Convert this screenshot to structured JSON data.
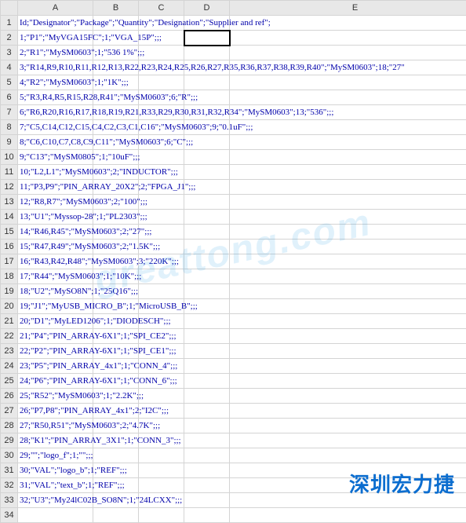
{
  "columns": [
    "A",
    "B",
    "C",
    "D",
    "E"
  ],
  "selected_cell": "D2",
  "watermark": "greattong.com",
  "logo_text": "深圳宏力捷",
  "rows": [
    {
      "n": 1,
      "text": "Id;\"Designator\";\"Package\";\"Quantity\";\"Designation\";\"Supplier and ref\";"
    },
    {
      "n": 2,
      "text": "1;\"P1\";\"MyVGA15FC\";1;\"VGA_15P\";;;"
    },
    {
      "n": 3,
      "text": "2;\"R1\";\"MySM0603\";1;\"536 1%\";;;"
    },
    {
      "n": 4,
      "text": "3;\"R14,R9,R10,R11,R12,R13,R22,R23,R24,R25,R26,R27,R35,R36,R37,R38,R39,R40\";\"MySM0603\";18;\"27\""
    },
    {
      "n": 5,
      "text": "4;\"R2\";\"MySM0603\";1;\"1K\";;;"
    },
    {
      "n": 6,
      "text": "5;\"R3,R4,R5,R15,R28,R41\";\"MySM0603\";6;\"R\";;;"
    },
    {
      "n": 7,
      "text": "6;\"R6,R20,R16,R17,R18,R19,R21,R33,R29,R30,R31,R32,R34\";\"MySM0603\";13;\"536\";;;"
    },
    {
      "n": 8,
      "text": "7;\"C5,C14,C12,C15,C4,C2,C3,C1,C16\";\"MySM0603\";9;\"0.1uF\";;;"
    },
    {
      "n": 9,
      "text": "8;\"C6,C10,C7,C8,C9,C11\";\"MySM0603\";6;\"C\";;;"
    },
    {
      "n": 10,
      "text": "9;\"C13\";\"MySM0805\";1;\"10uF\";;;"
    },
    {
      "n": 11,
      "text": "10;\"L2,L1\";\"MySM0603\";2;\"INDUCTOR\";;;"
    },
    {
      "n": 12,
      "text": "11;\"P3,P9\";\"PIN_ARRAY_20X2\";2;\"FPGA_J1\";;;"
    },
    {
      "n": 13,
      "text": "12;\"R8,R7\";\"MySM0603\";2;\"100\";;;"
    },
    {
      "n": 14,
      "text": "13;\"U1\";\"Myssop-28\";1;\"PL2303\";;;"
    },
    {
      "n": 15,
      "text": "14;\"R46,R45\";\"MySM0603\";2;\"27\";;;"
    },
    {
      "n": 16,
      "text": "15;\"R47,R49\";\"MySM0603\";2;\"1.5K\";;;"
    },
    {
      "n": 17,
      "text": "16;\"R43,R42,R48\";\"MySM0603\";3;\"220K\";;;"
    },
    {
      "n": 18,
      "text": "17;\"R44\";\"MySM0603\";1;\"10K\";;;"
    },
    {
      "n": 19,
      "text": "18;\"U2\";\"MySO8N\";1;\"25Q16\";;;"
    },
    {
      "n": 20,
      "text": "19;\"J1\";\"MyUSB_MICRO_B\";1;\"MicroUSB_B\";;;"
    },
    {
      "n": 21,
      "text": "20;\"D1\";\"MyLED1206\";1;\"DIODESCH\";;;"
    },
    {
      "n": 22,
      "text": "21;\"P4\";\"PIN_ARRAY-6X1\";1;\"SPI_CE2\";;;"
    },
    {
      "n": 23,
      "text": "22;\"P2\";\"PIN_ARRAY-6X1\";1;\"SPI_CE1\";;;"
    },
    {
      "n": 24,
      "text": "23;\"P5\";\"PIN_ARRAY_4x1\";1;\"CONN_4\";;;"
    },
    {
      "n": 25,
      "text": "24;\"P6\";\"PIN_ARRAY-6X1\";1;\"CONN_6\";;;"
    },
    {
      "n": 26,
      "text": "25;\"R52\";\"MySM0603\";1;\"2.2K\";;;"
    },
    {
      "n": 27,
      "text": "26;\"P7,P8\";\"PIN_ARRAY_4x1\";2;\"I2C\";;;"
    },
    {
      "n": 28,
      "text": "27;\"R50,R51\";\"MySM0603\";2;\"4.7K\";;;"
    },
    {
      "n": 29,
      "text": "28;\"K1\";\"PIN_ARRAY_3X1\";1;\"CONN_3\";;;"
    },
    {
      "n": 30,
      "text": "29;\"\";\"logo_f\";1;\"\";;;"
    },
    {
      "n": 31,
      "text": "30;\"VAL\";\"logo_b\";1;\"REF\";;;"
    },
    {
      "n": 32,
      "text": "31;\"VAL\";\"text_b\";1;\"REF\";;;"
    },
    {
      "n": 33,
      "text": "32;\"U3\";\"My24lC02B_SO8N\";1;\"24LCXX\";;;"
    },
    {
      "n": 34,
      "text": ""
    }
  ]
}
